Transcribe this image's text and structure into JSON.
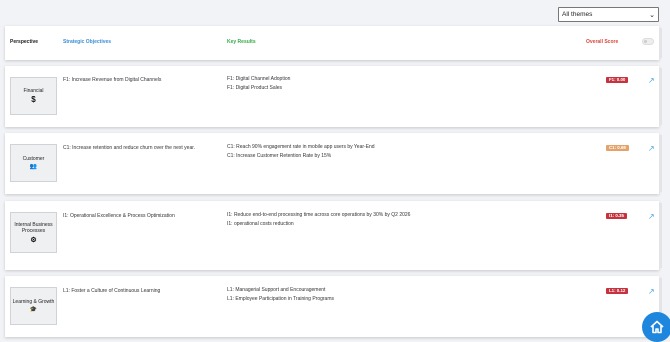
{
  "theme_select": {
    "value": "All themes"
  },
  "header": {
    "perspective": "Perspective",
    "objectives": "Strategic Objectives",
    "key_results": "Key Results",
    "score": "Overall Score"
  },
  "rows": [
    {
      "perspective": "Financial",
      "icon": "dollar-icon",
      "icon_glyph": "$",
      "objective": "F1: Increase Revenue from Digital Channels",
      "key_results": [
        "F1: Digital Channel Adoption",
        "F1: Digital Product Sales"
      ],
      "score": "F1: 0.00",
      "score_color": "#c6333e"
    },
    {
      "perspective": "Customer",
      "icon": "users-icon",
      "icon_glyph": "👥",
      "objective": "C1: Increase retention and reduce churn over the next year.",
      "key_results": [
        "C1: Reach 90% engagement rate in mobile app users by Year-End",
        "C1: Increase Customer Retention Rate by 15%"
      ],
      "score": "C1: 0.69",
      "score_color": "#e3a36a"
    },
    {
      "perspective_line1": "Internal Business",
      "perspective_line2": "Processes",
      "icon": "gears-icon",
      "icon_glyph": "⚙",
      "objective": "I1: Operational Excellence & Process Optimization",
      "key_results": [
        "I1: Reduce end-to-end processing time across core operations by 30% by Q2 2026",
        "I1: operational costs reduction"
      ],
      "score": "I1: 0.35",
      "score_color": "#c6333e"
    },
    {
      "perspective": "Learning & Growth",
      "icon": "graduation-cap-icon",
      "icon_glyph": "🎓",
      "objective": "L1: Foster a Culture of Continuous Learning",
      "key_results": [
        "L1: Managerial Support and Encouragement",
        "L1: Employee Participation in Training Programs"
      ],
      "score": "L1: 0.12",
      "score_color": "#c6333e"
    }
  ]
}
